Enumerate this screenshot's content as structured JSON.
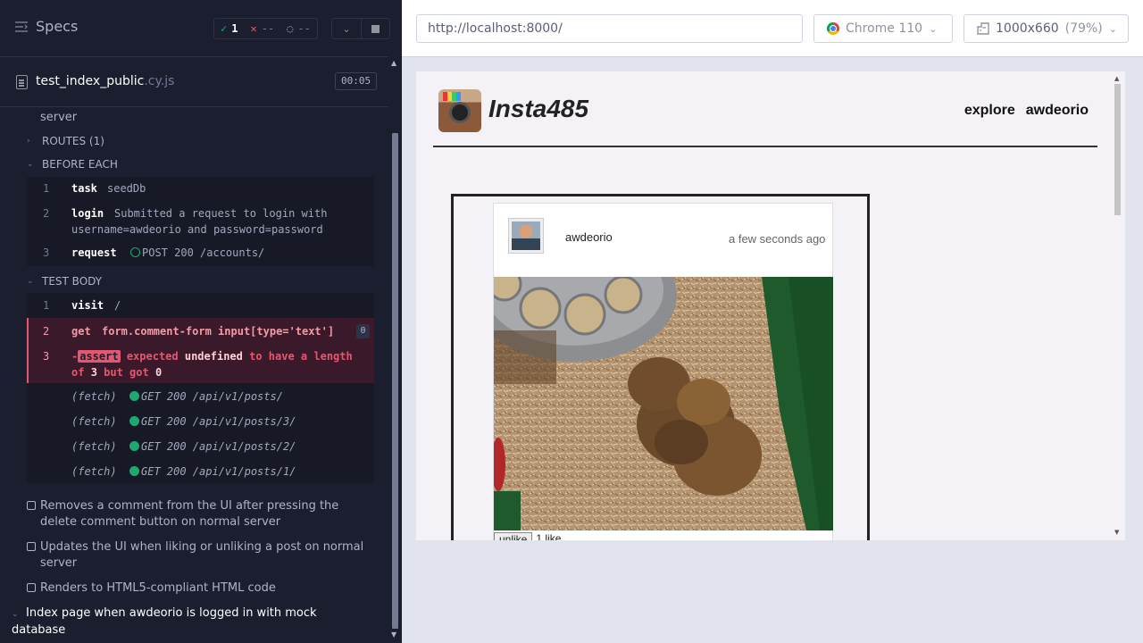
{
  "runner": {
    "title": "Specs",
    "passed": "1",
    "failed": "--",
    "pending": "--",
    "file_name": "test_index_public",
    "file_ext": ".cy.js",
    "timer": "00:05",
    "cut_title": "server",
    "sections": {
      "routes": "ROUTES (1)",
      "before_each": "BEFORE EACH",
      "test_body": "TEST BODY"
    },
    "before_each": [
      {
        "num": "1",
        "name": "task",
        "msg": "seedDb"
      },
      {
        "num": "2",
        "name": "login",
        "msg": "Submitted a request to login with",
        "msg2": "username=awdeorio and password=password"
      },
      {
        "num": "3",
        "name": "request",
        "msg": "POST 200 /accounts/"
      }
    ],
    "body": [
      {
        "num": "1",
        "name": "visit",
        "msg": "/"
      },
      {
        "num": "2",
        "name": "get",
        "msg": "form.comment-form input[type='text']",
        "badge": "0"
      },
      {
        "num": "3",
        "dash": "-",
        "name": "assert",
        "msg_parts": [
          "expected",
          "undefined",
          "to have a length"
        ],
        "msg2_parts": [
          "of",
          "3",
          "but got",
          "0"
        ]
      }
    ],
    "fetches": [
      {
        "name": "(fetch)",
        "msg": "GET 200 /api/v1/posts/"
      },
      {
        "name": "(fetch)",
        "msg": "GET 200 /api/v1/posts/3/"
      },
      {
        "name": "(fetch)",
        "msg": "GET 200 /api/v1/posts/2/"
      },
      {
        "name": "(fetch)",
        "msg": "GET 200 /api/v1/posts/1/"
      }
    ],
    "tests": [
      "Removes a comment from the UI after pressing the delete comment button on normal server",
      "Updates the UI when liking or unliking a post on normal server",
      "Renders to HTML5-compliant HTML code"
    ],
    "suite": "Index page when awdeorio is logged in with mock database"
  },
  "browser_bar": {
    "url": "http://localhost:8000/",
    "browser": "Chrome 110",
    "viewport": "1000x660",
    "zoom": "(79%)"
  },
  "app": {
    "brand": "Insta485",
    "nav_explore": "explore",
    "nav_user": "awdeorio",
    "post_user": "awdeorio",
    "post_time": "a few seconds ago",
    "like_button": "unlike",
    "likes": "1 like"
  }
}
